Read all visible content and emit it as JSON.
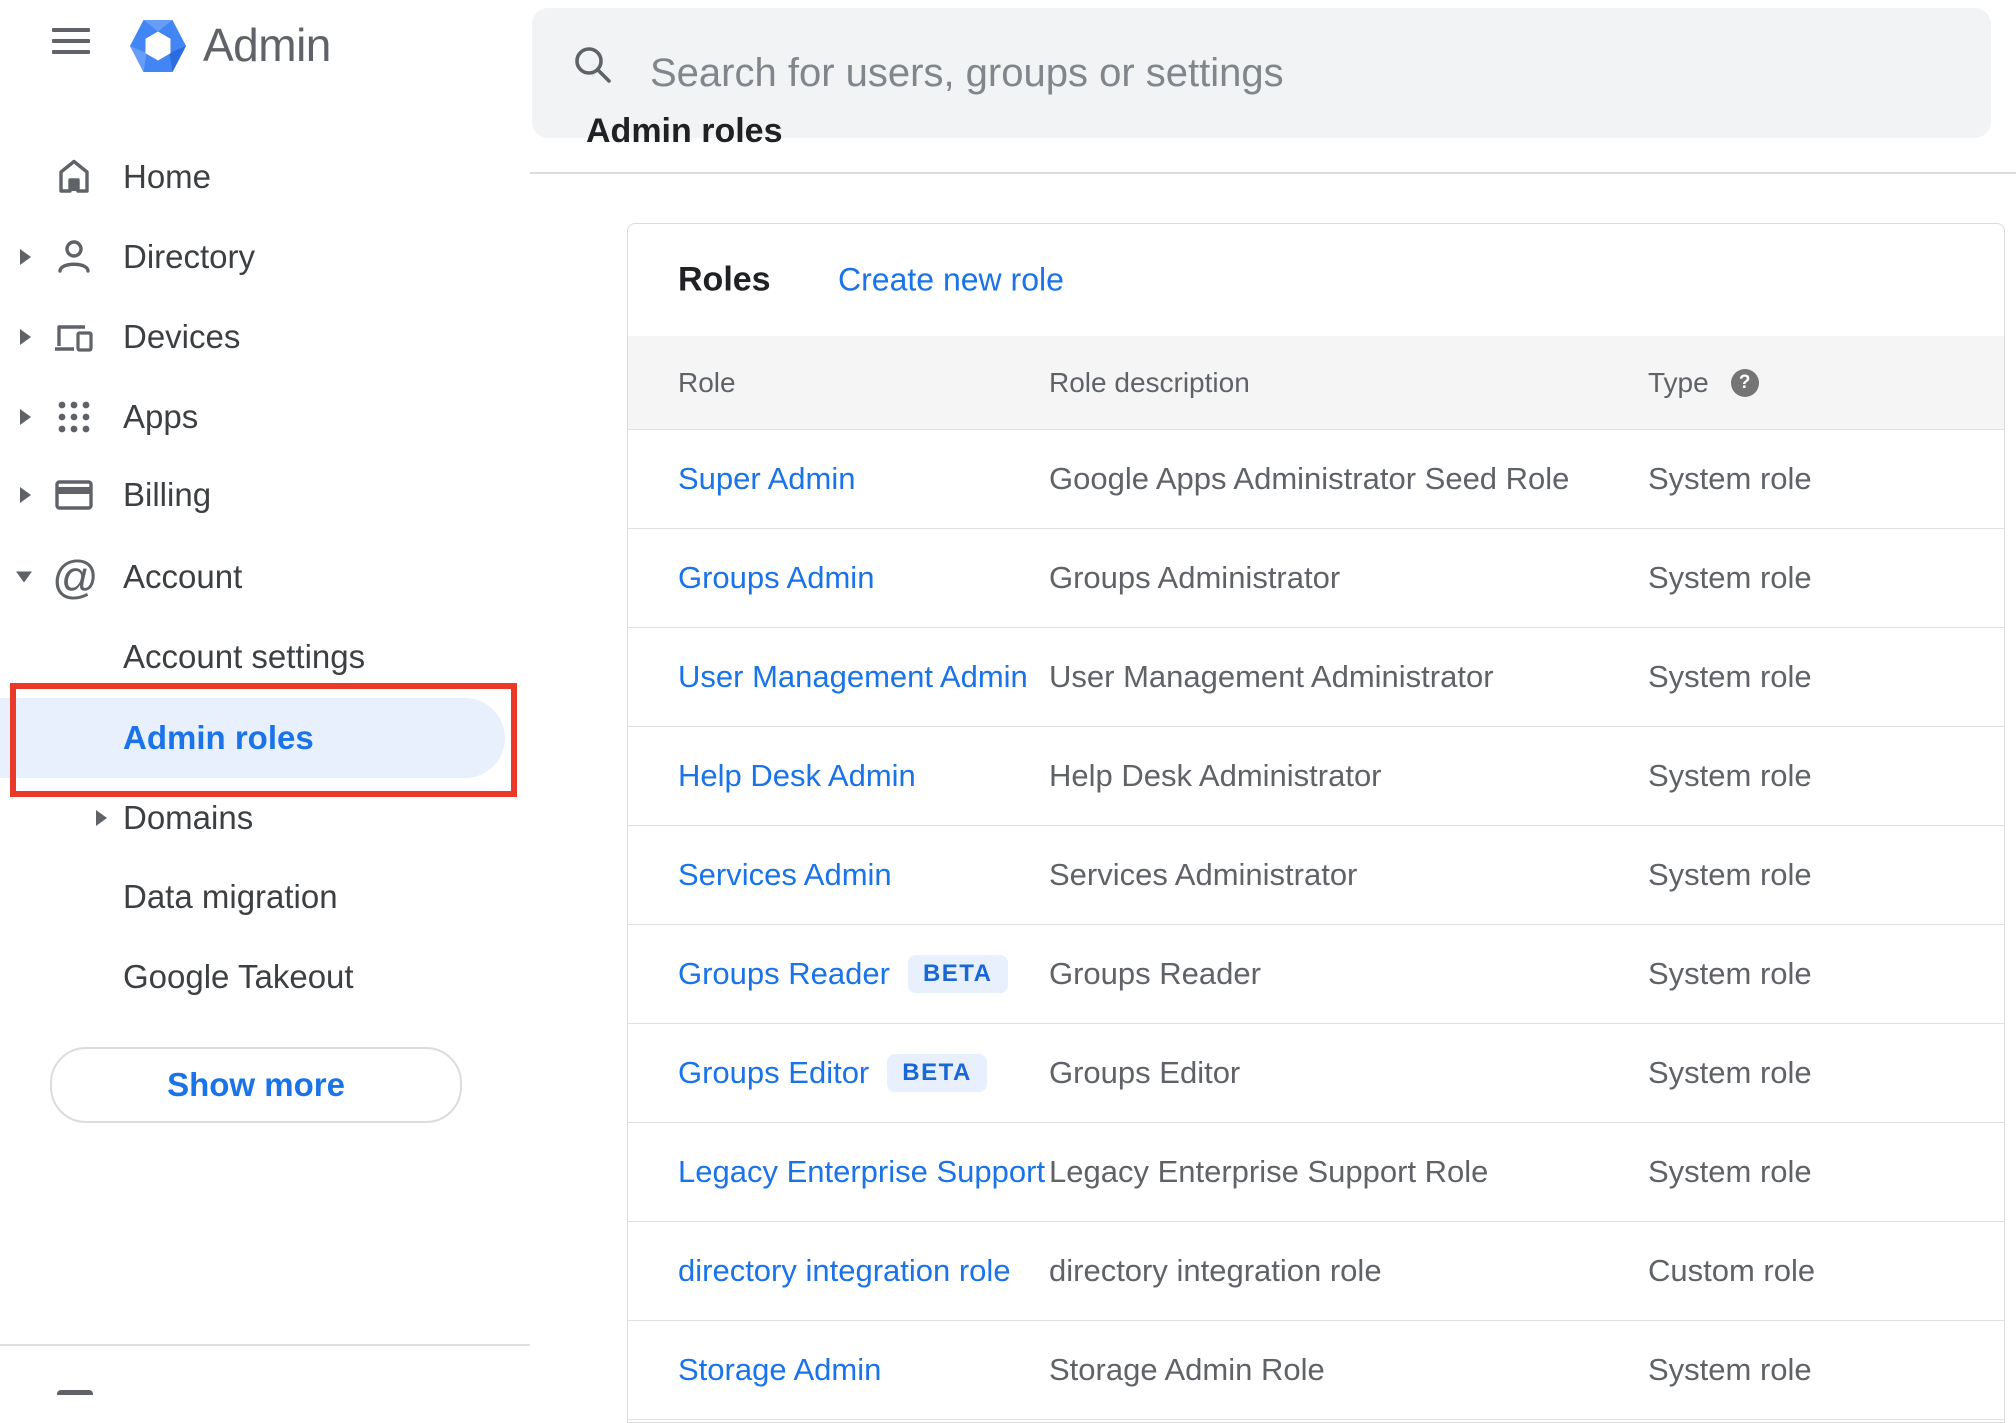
{
  "app": {
    "title": "Admin"
  },
  "search": {
    "placeholder": "Search for users, groups or settings"
  },
  "breadcrumb": "Admin roles",
  "sidebar": {
    "items": [
      {
        "label": "Home"
      },
      {
        "label": "Directory"
      },
      {
        "label": "Devices"
      },
      {
        "label": "Apps"
      },
      {
        "label": "Billing"
      },
      {
        "label": "Account"
      }
    ],
    "account_children": [
      {
        "label": "Account settings"
      },
      {
        "label": "Admin roles",
        "selected": true
      },
      {
        "label": "Domains"
      },
      {
        "label": "Data migration"
      },
      {
        "label": "Google Takeout"
      }
    ],
    "show_more_label": "Show more",
    "account_at_glyph": "@"
  },
  "roles_panel": {
    "title": "Roles",
    "create_link": "Create new role",
    "columns": [
      "Role",
      "Role description",
      "Type"
    ],
    "type_help_glyph": "?",
    "rows": [
      {
        "role": "Super Admin",
        "description": "Google Apps Administrator Seed Role",
        "type": "System role"
      },
      {
        "role": "Groups Admin",
        "description": "Groups Administrator",
        "type": "System role"
      },
      {
        "role": "User Management Admin",
        "description": "User Management Administrator",
        "type": "System role"
      },
      {
        "role": "Help Desk Admin",
        "description": "Help Desk Administrator",
        "type": "System role"
      },
      {
        "role": "Services Admin",
        "description": "Services Administrator",
        "type": "System role"
      },
      {
        "role": "Groups Reader",
        "beta": "BETA",
        "description": "Groups Reader",
        "type": "System role"
      },
      {
        "role": "Groups Editor",
        "beta": "BETA",
        "description": "Groups Editor",
        "type": "System role"
      },
      {
        "role": "Legacy Enterprise Support",
        "description": "Legacy Enterprise Support Role",
        "type": "System role"
      },
      {
        "role": "directory integration role",
        "description": "directory integration role",
        "type": "Custom role"
      },
      {
        "role": "Storage Admin",
        "description": "Storage Admin Role",
        "type": "System role"
      }
    ]
  },
  "colors": {
    "accent_blue": "#1a73e8",
    "selected_pill": "#e8f0fe",
    "annotation_red": "#ea3829",
    "header_band": "#f5f5f5",
    "search_bg": "#f1f3f4",
    "divider": "#e0e0e0",
    "text_gray": "#5f6368"
  }
}
